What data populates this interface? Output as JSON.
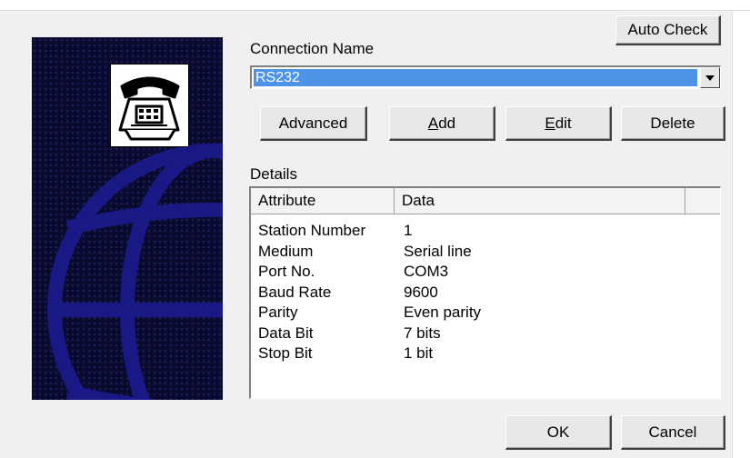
{
  "connection": {
    "label": "Connection Name",
    "selected": "RS232"
  },
  "buttons": {
    "auto_check": "Auto Check",
    "advanced": "Advanced",
    "add_ul": "A",
    "add_rest": "dd",
    "edit_ul": "E",
    "edit_rest": "dit",
    "delete": "Delete",
    "ok": "OK",
    "cancel": "Cancel"
  },
  "details": {
    "label": "Details",
    "columns": [
      "Attribute",
      "Data"
    ],
    "rows": [
      {
        "attribute": "Station Number",
        "data": "1"
      },
      {
        "attribute": "Medium",
        "data": "Serial line"
      },
      {
        "attribute": "Port No.",
        "data": "COM3"
      },
      {
        "attribute": "Baud Rate",
        "data": "9600"
      },
      {
        "attribute": "Parity",
        "data": "Even parity"
      },
      {
        "attribute": "Data Bit",
        "data": "7 bits"
      },
      {
        "attribute": "Stop Bit",
        "data": "1 bit"
      }
    ]
  },
  "icons": {
    "banner": "globe-grid-icon",
    "phone": "telephone-icon",
    "dropdown": "chevron-down-icon"
  },
  "colors": {
    "selection": "#4d94e8",
    "banner_bg": "#0a0a2e",
    "globe": "#1a1a8a"
  }
}
